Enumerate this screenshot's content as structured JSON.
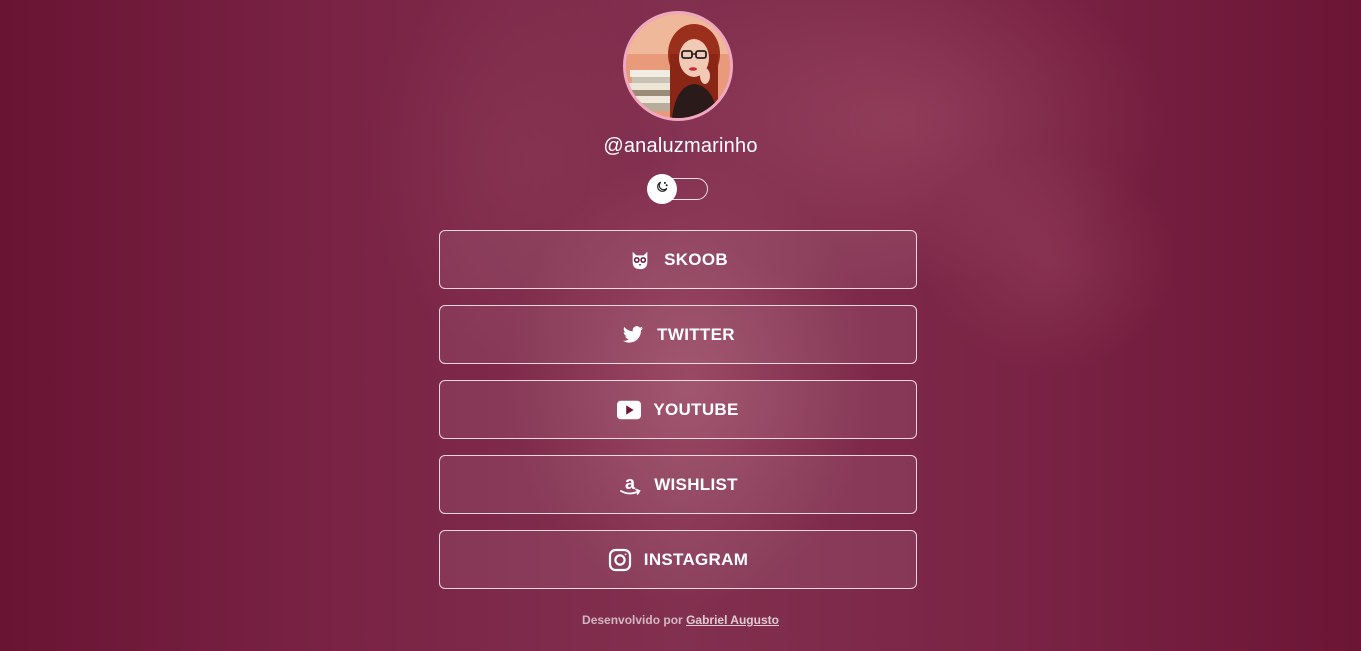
{
  "profile": {
    "username": "@analuzmarinho"
  },
  "theme_toggle": {
    "icon": "moon-icon",
    "state": "off"
  },
  "links": [
    {
      "label": "SKOOB",
      "icon": "owl-icon"
    },
    {
      "label": "TWITTER",
      "icon": "twitter-icon"
    },
    {
      "label": "YOUTUBE",
      "icon": "youtube-icon"
    },
    {
      "label": "WISHLIST",
      "icon": "amazon-icon"
    },
    {
      "label": "INSTAGRAM",
      "icon": "instagram-icon"
    }
  ],
  "footer": {
    "prefix": "Desenvolvido por",
    "author": "Gabriel Augusto"
  },
  "colors": {
    "background": "#6e1636",
    "avatar_ring": "#f0a8c0",
    "text": "#ffffff"
  }
}
